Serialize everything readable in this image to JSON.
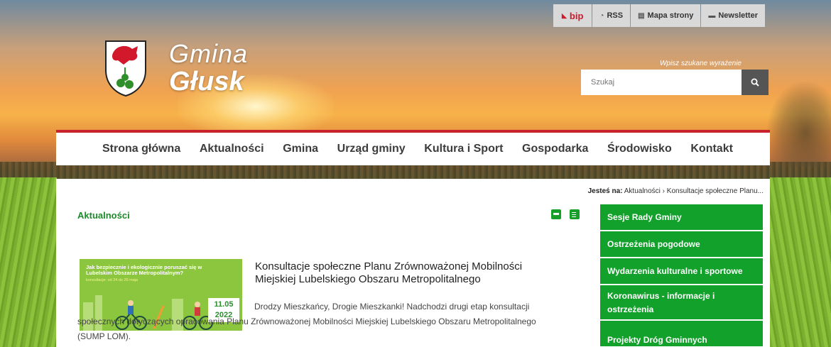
{
  "topbar": {
    "bip_label": "bip",
    "rss_label": "RSS",
    "sitemap_label": "Mapa strony",
    "newsletter_label": "Newsletter"
  },
  "logo": {
    "line1": "Gmina",
    "line2": "Głusk"
  },
  "search": {
    "hint": "Wpisz szukane wyrażenie",
    "placeholder": "Szukaj"
  },
  "nav": {
    "items": [
      "Strona główna",
      "Aktualności",
      "Gmina",
      "Urząd gminy",
      "Kultura i Sport",
      "Gospodarka",
      "Środowisko",
      "Kontakt"
    ]
  },
  "breadcrumb": {
    "prefix": "Jesteś na:",
    "path": "Aktualności › Konsultacje społeczne Planu..."
  },
  "section": {
    "title": "Aktualności"
  },
  "article": {
    "thumb_headline": "Jak bezpiecznie i ekologicznie poruszać się w Lubelskim Obszarze Metropolitalnym?",
    "thumb_sub": "konsultacje: od 24 do 26 maja",
    "date_day": "11.05",
    "date_year": "2022",
    "title": "Konsultacje społeczne Planu Zrównoważonej Mobilności Miejskiej Lubelskiego Obszaru Metropolitalnego",
    "excerpt": "Drodzy Mieszkańcy, Drogie Mieszkanki! Nadchodzi drugi etap konsultacji społecznych dotyczących opracowania Planu Zrównoważonej Mobilności Miejskiej Lubelskiego Obszaru Metropolitalnego (SUMP LOM)."
  },
  "sidebar": {
    "items": [
      "Sesje Rady Gminy",
      "Ostrzeżenia pogodowe",
      "Wydarzenia kulturalne i sportowe",
      "Koronawirus - informacje i ostrzeżenia",
      "Projekty Dróg Gminnych"
    ]
  },
  "colors": {
    "accent_red": "#c8232c",
    "green": "#12a12b"
  }
}
